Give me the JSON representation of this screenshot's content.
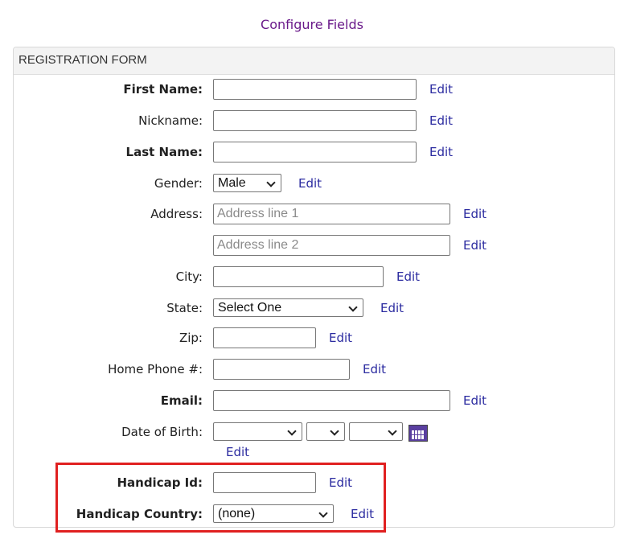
{
  "header": {
    "configure_link": "Configure Fields"
  },
  "form": {
    "title": "REGISTRATION FORM",
    "edit_label": "Edit",
    "first_name": {
      "label": "First Name:",
      "value": ""
    },
    "nickname": {
      "label": "Nickname:",
      "value": ""
    },
    "last_name": {
      "label": "Last Name:",
      "value": ""
    },
    "gender": {
      "label": "Gender:",
      "selected": "Male"
    },
    "address": {
      "label": "Address:",
      "line1_placeholder": "Address line 1",
      "line2_placeholder": "Address line 2"
    },
    "city": {
      "label": "City:",
      "value": ""
    },
    "state": {
      "label": "State:",
      "selected": "Select One"
    },
    "zip": {
      "label": "Zip:",
      "value": ""
    },
    "home_phone": {
      "label": "Home Phone #:",
      "value": ""
    },
    "email": {
      "label": "Email:",
      "value": ""
    },
    "dob": {
      "label": "Date of Birth:",
      "month": "",
      "day": "",
      "year": ""
    },
    "handicap_id": {
      "label": "Handicap Id:",
      "value": ""
    },
    "handicap_country": {
      "label": "Handicap Country:",
      "selected": "(none)"
    }
  },
  "colors": {
    "link": "#2b2ba0",
    "top_link": "#6a1a8a",
    "highlight": "#e02020"
  },
  "icons": {
    "calendar": "calendar-icon"
  }
}
